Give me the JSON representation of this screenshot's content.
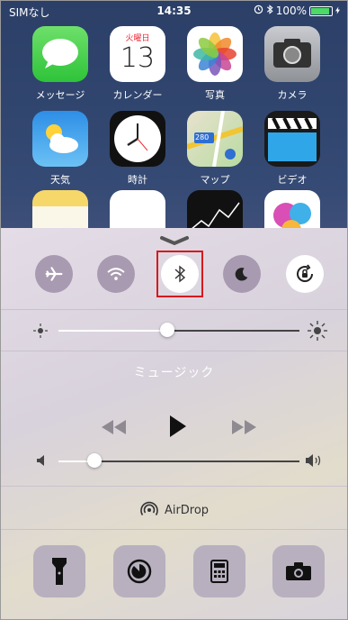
{
  "status_bar": {
    "carrier": "SIMなし",
    "time": "14:35",
    "battery_percent": "100%"
  },
  "home_screen": {
    "apps": [
      {
        "label": "メッセージ",
        "icon": "messages-icon"
      },
      {
        "label": "カレンダー",
        "icon": "calendar-icon",
        "weekday": "火曜日",
        "day": "13"
      },
      {
        "label": "写真",
        "icon": "photos-icon"
      },
      {
        "label": "カメラ",
        "icon": "camera-app-icon"
      },
      {
        "label": "天気",
        "icon": "weather-icon"
      },
      {
        "label": "時計",
        "icon": "clock-icon"
      },
      {
        "label": "マップ",
        "icon": "maps-icon",
        "badge": "280"
      },
      {
        "label": "ビデオ",
        "icon": "videos-icon"
      }
    ]
  },
  "control_center": {
    "toggles": [
      {
        "name": "airplane-mode",
        "icon": "airplane-icon",
        "on": false
      },
      {
        "name": "wifi",
        "icon": "wifi-icon",
        "on": false
      },
      {
        "name": "bluetooth",
        "icon": "bluetooth-icon",
        "on": true,
        "highlighted": true
      },
      {
        "name": "do-not-disturb",
        "icon": "moon-icon",
        "on": false
      },
      {
        "name": "rotation-lock",
        "icon": "rotation-lock-icon",
        "on": true
      }
    ],
    "brightness_level": 0.45,
    "music": {
      "title": "ミュージック"
    },
    "volume_level": 0.15,
    "airdrop_label": "AirDrop",
    "shortcuts": [
      {
        "name": "flashlight",
        "icon": "flashlight-icon"
      },
      {
        "name": "timer",
        "icon": "timer-icon"
      },
      {
        "name": "calculator",
        "icon": "calculator-icon"
      },
      {
        "name": "camera",
        "icon": "camera-icon"
      }
    ],
    "colors": {
      "highlight_box": "#d7191e",
      "toggle_off": "#a89ab0",
      "toggle_on": "#ffffff"
    }
  }
}
